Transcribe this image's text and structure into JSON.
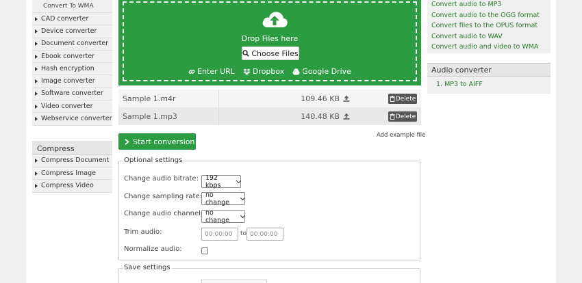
{
  "sidebar": {
    "sub_item": "Convert To WMA",
    "items": [
      "CAD converter",
      "Device converter",
      "Document converter",
      "Ebook converter",
      "Hash encryption",
      "Image converter",
      "Software converter",
      "Video converter",
      "Webservice converter"
    ],
    "compress_header": "Compress",
    "compress_items": [
      "Compress Document",
      "Compress Image",
      "Compress Video"
    ]
  },
  "upload": {
    "drop_text": "Drop Files here",
    "choose_label": "Choose Files",
    "enter_url": "Enter URL",
    "dropbox": "Dropbox",
    "google_drive": "Google Drive"
  },
  "files": [
    {
      "name": "Sample 1.m4r",
      "size": "109.46 KB",
      "delete": "Delete"
    },
    {
      "name": "Sample 1.mp3",
      "size": "140.48 KB",
      "delete": "Delete"
    }
  ],
  "actions": {
    "start_label": "Start conversion",
    "add_example": "Add example file"
  },
  "optional": {
    "legend": "Optional settings",
    "bitrate_label": "Change audio bitrate:",
    "bitrate_value": "192 kbps",
    "sampling_label": "Change sampling rate:",
    "sampling_value": "no change",
    "channels_label": "Change audio channels:",
    "channels_value": "no change",
    "trim_label": "Trim audio:",
    "trim_from_placeholder": "00:00:00",
    "trim_to_text": "to",
    "trim_to_placeholder": "00:00:00",
    "normalize_label": "Normalize audio:"
  },
  "save": {
    "legend": "Save settings"
  },
  "right": {
    "links": [
      "Convert audio to MP3",
      "Convert audio to the OGG format",
      "Convert files to the OPUS format",
      "Convert audio to WAV",
      "Convert audio and video to WMA"
    ],
    "audio_header": "Audio converter",
    "audio_item": "1. MP3 to AIFF"
  },
  "colors": {
    "brand_green": "#2c9c43",
    "link_green": "#2a7a2a",
    "delete_gray": "#555555"
  }
}
